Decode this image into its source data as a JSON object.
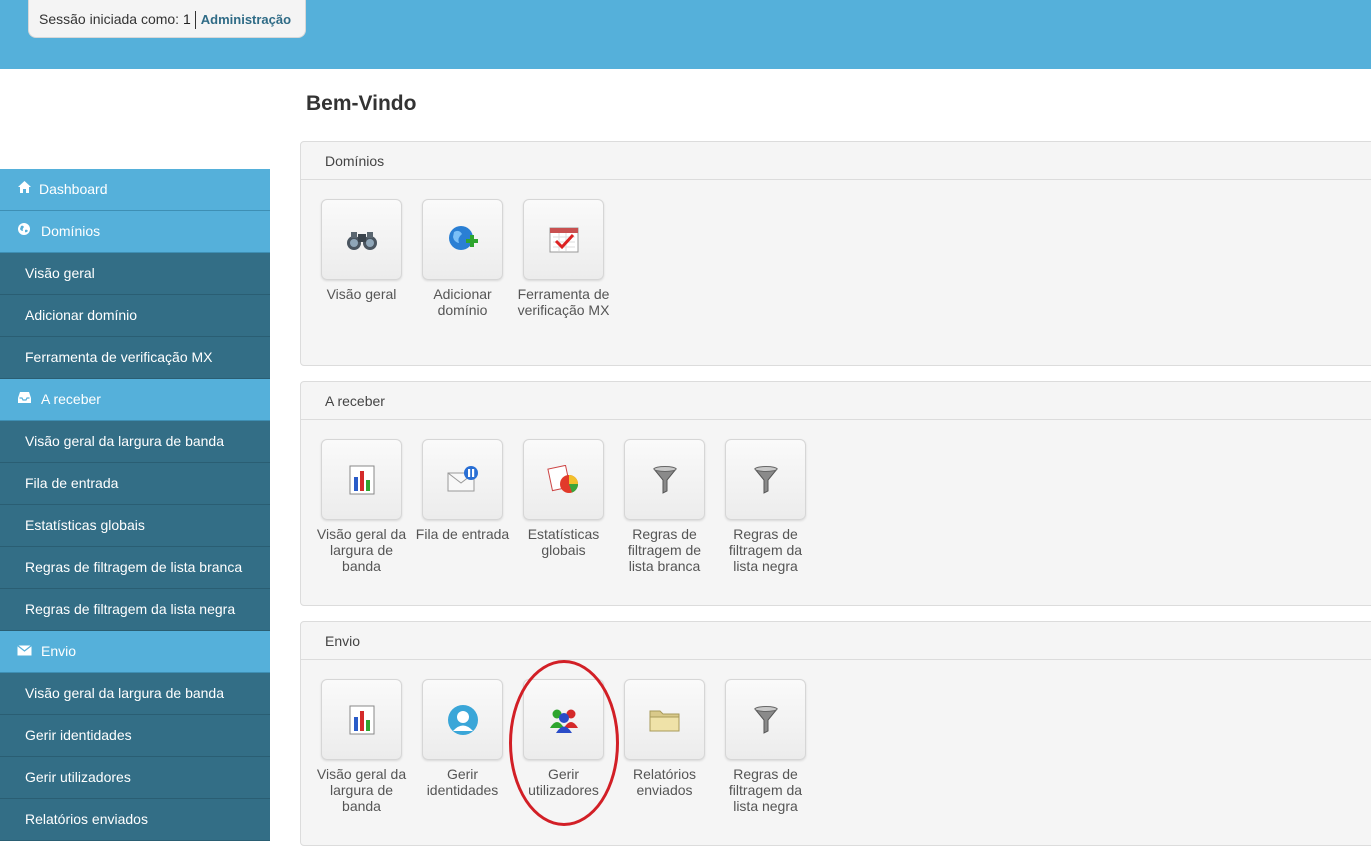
{
  "session": {
    "label": "Sessão iniciada como:",
    "user_id": "1",
    "role": "Administração"
  },
  "page_title": "Bem-Vindo",
  "sidebar": {
    "items": [
      {
        "label": "Dashboard",
        "type": "section",
        "icon": "home-icon"
      },
      {
        "label": "Domínios",
        "type": "section",
        "icon": "globe-icon"
      },
      {
        "label": "Visão geral",
        "type": "sub"
      },
      {
        "label": "Adicionar domínio",
        "type": "sub"
      },
      {
        "label": "Ferramenta de verificação MX",
        "type": "sub"
      },
      {
        "label": "A receber",
        "type": "section",
        "icon": "inbox-icon"
      },
      {
        "label": "Visão geral da largura de banda",
        "type": "sub"
      },
      {
        "label": "Fila de entrada",
        "type": "sub"
      },
      {
        "label": "Estatísticas globais",
        "type": "sub"
      },
      {
        "label": "Regras de filtragem de lista branca",
        "type": "sub"
      },
      {
        "label": "Regras de filtragem da lista negra",
        "type": "sub"
      },
      {
        "label": "Envio",
        "type": "section",
        "icon": "envelope-icon"
      },
      {
        "label": "Visão geral da largura de banda",
        "type": "sub"
      },
      {
        "label": "Gerir identidades",
        "type": "sub"
      },
      {
        "label": "Gerir utilizadores",
        "type": "sub"
      },
      {
        "label": "Relatórios enviados",
        "type": "sub"
      }
    ]
  },
  "panels": {
    "dominios": {
      "title": "Domínios",
      "tiles": [
        {
          "label": "Visão geral",
          "icon": "binoculars-icon"
        },
        {
          "label": "Adicionar domínio",
          "icon": "globe-add-icon"
        },
        {
          "label": "Ferramenta de verificação MX",
          "icon": "calendar-check-icon"
        }
      ]
    },
    "receber": {
      "title": "A receber",
      "tiles": [
        {
          "label": "Visão geral da largura de banda",
          "icon": "bar-chart-icon"
        },
        {
          "label": "Fila de entrada",
          "icon": "mail-pause-icon"
        },
        {
          "label": "Estatísticas globais",
          "icon": "pie-chart-icon"
        },
        {
          "label": "Regras de filtragem de lista branca",
          "icon": "funnel-icon"
        },
        {
          "label": "Regras de filtragem da lista negra",
          "icon": "funnel-icon"
        }
      ]
    },
    "envio": {
      "title": "Envio",
      "tiles": [
        {
          "label": "Visão geral da largura de banda",
          "icon": "bar-chart-icon"
        },
        {
          "label": "Gerir identidades",
          "icon": "user-avatar-icon"
        },
        {
          "label": "Gerir utilizadores",
          "icon": "users-group-icon"
        },
        {
          "label": "Relatórios enviados",
          "icon": "folder-icon"
        },
        {
          "label": "Regras de filtragem da lista negra",
          "icon": "funnel-icon"
        }
      ]
    }
  },
  "colors": {
    "topbar": "#55b0da",
    "sidebar_section": "#55b0da",
    "sidebar_sub": "#336e86",
    "highlight": "#d21f26"
  }
}
